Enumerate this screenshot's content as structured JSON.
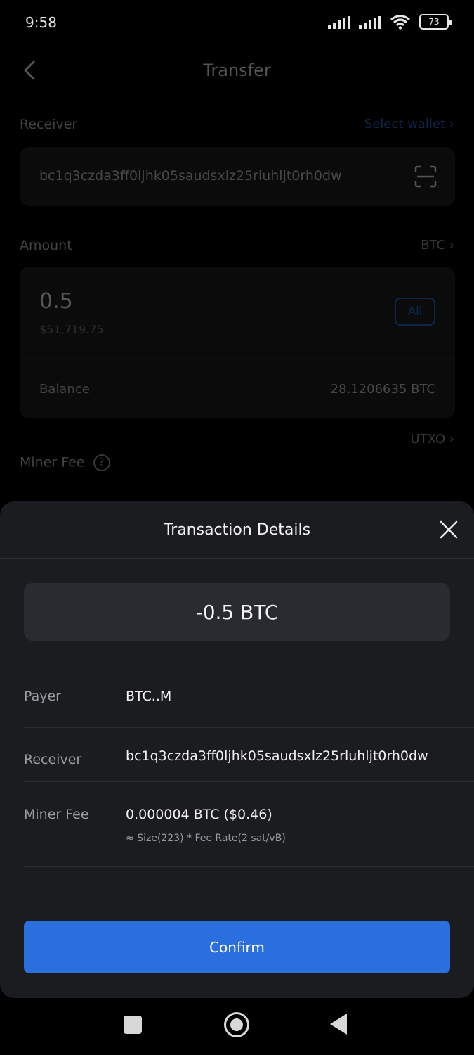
{
  "status_bar": {
    "time": "9:58",
    "battery": "73"
  },
  "transfer_page": {
    "title": "Transfer",
    "receiver_label": "Receiver",
    "select_wallet": "Select wallet",
    "receiver_address": "bc1q3czda3ff0ljhk05saudsxlz25rluhljt0rh0dw",
    "amount_label": "Amount",
    "currency": "BTC",
    "amount_value": "0.5",
    "amount_fiat": "$51,719.75",
    "all_label": "All",
    "balance_label": "Balance",
    "balance_value": "28.1206635 BTC",
    "utxo_label": "UTXO",
    "miner_fee_label": "Miner Fee"
  },
  "sheet": {
    "title": "Transaction Details",
    "amount": "-0.5 BTC",
    "rows": [
      {
        "label": "Payer",
        "value": "BTC..M"
      },
      {
        "label": "Receiver",
        "value": "bc1q3czda3ff0ljhk05saudsxlz25rluhljt0rh0dw"
      },
      {
        "label": "Miner Fee",
        "value": "0.000004 BTC ($0.46)",
        "sub": "≈ Size(223) * Fee Rate(2 sat/vB)"
      }
    ],
    "confirm_label": "Confirm"
  },
  "colors": {
    "accent": "#2b6fde",
    "sheet_bg": "#1b1c20"
  }
}
